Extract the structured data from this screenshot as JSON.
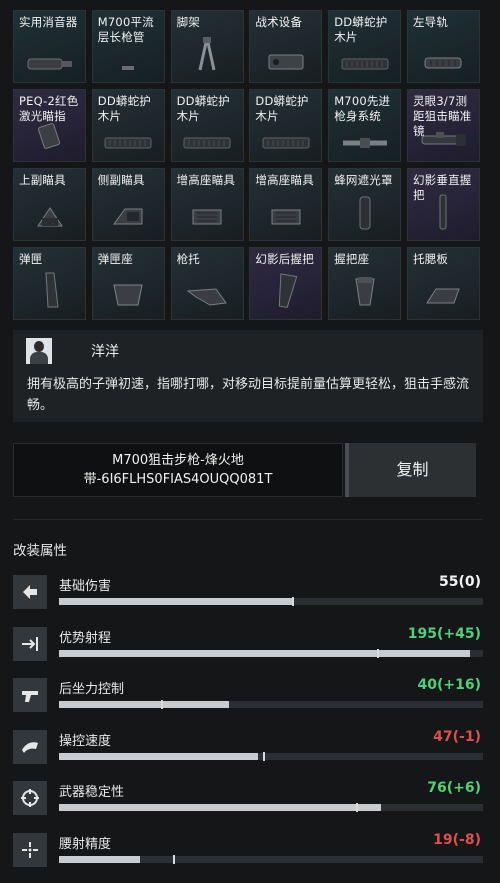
{
  "parts": [
    {
      "label": "实用消音器",
      "icon": "suppressor-icon",
      "bg": "teal"
    },
    {
      "label": "M700平流层长枪管",
      "icon": "barrel-icon",
      "bg": "teal"
    },
    {
      "label": "脚架",
      "icon": "bipod-icon",
      "bg": "dark"
    },
    {
      "label": "战术设备",
      "icon": "tactical-device-icon",
      "bg": "dark"
    },
    {
      "label": "DD蟒蛇护木片",
      "icon": "handguard-panel-icon",
      "bg": "teal"
    },
    {
      "label": "左导轨",
      "icon": "rail-icon",
      "bg": "teal"
    },
    {
      "label": "PEQ-2红色激光瞄指",
      "icon": "laser-icon",
      "bg": "purple"
    },
    {
      "label": "DD蟒蛇护木片",
      "icon": "handguard-panel-icon",
      "bg": "dark"
    },
    {
      "label": "DD蟒蛇护木片",
      "icon": "handguard-panel-icon",
      "bg": "dark"
    },
    {
      "label": "DD蟒蛇护木片",
      "icon": "handguard-panel-icon",
      "bg": "dark"
    },
    {
      "label": "M700先进枪身系统",
      "icon": "chassis-icon",
      "bg": "teal"
    },
    {
      "label": "灵眼3/7测距狙击瞄准镜",
      "icon": "scope-icon",
      "bg": "purple"
    },
    {
      "label": "上副瞄具",
      "icon": "sight-mount-icon",
      "bg": "dark"
    },
    {
      "label": "侧副瞄具",
      "icon": "side-sight-icon",
      "bg": "dark"
    },
    {
      "label": "增高座瞄具",
      "icon": "riser-mount-icon",
      "bg": "dark"
    },
    {
      "label": "增高座瞄具",
      "icon": "riser-mount-icon",
      "bg": "dark"
    },
    {
      "label": "蜂网遮光罩",
      "icon": "honeycomb-icon",
      "bg": "dark"
    },
    {
      "label": "幻影垂直握把",
      "icon": "vertical-grip-icon",
      "bg": "purple"
    },
    {
      "label": "弹匣",
      "icon": "magazine-icon",
      "bg": "dark"
    },
    {
      "label": "弹匣座",
      "icon": "magwell-icon",
      "bg": "dark"
    },
    {
      "label": "枪托",
      "icon": "stock-icon",
      "bg": "dark"
    },
    {
      "label": "幻影后握把",
      "icon": "pistol-grip-icon",
      "bg": "purple"
    },
    {
      "label": "握把座",
      "icon": "grip-mount-icon",
      "bg": "dark"
    },
    {
      "label": "托腮板",
      "icon": "cheek-rest-icon",
      "bg": "dark"
    }
  ],
  "description": {
    "author": "洋洋",
    "text": "拥有极高的子弹初速，指哪打哪，对移动目标提前量估算更轻松，狙击手感流畅。"
  },
  "code": {
    "line1": "M700狙击步枪-烽火地",
    "line2": "带-6I6FLHS0FIAS4OUQQ081T",
    "copy_label": "复制"
  },
  "attributes_title": "改装属性",
  "attributes": [
    {
      "name": "基础伤害",
      "value": "55(0)",
      "color": "#f2f2f2",
      "icon": "damage-icon",
      "fill": 0.55,
      "mark": 0.55
    },
    {
      "name": "优势射程",
      "value": "195(+45)",
      "color": "#4fd17a",
      "icon": "range-icon",
      "fill": 0.97,
      "mark": 0.75
    },
    {
      "name": "后坐力控制",
      "value": "40(+16)",
      "color": "#4fd17a",
      "icon": "recoil-icon",
      "fill": 0.4,
      "mark": 0.24
    },
    {
      "name": "操控速度",
      "value": "47(-1)",
      "color": "#e0504a",
      "icon": "handling-icon",
      "fill": 0.47,
      "mark": 0.48
    },
    {
      "name": "武器稳定性",
      "value": "76(+6)",
      "color": "#4fd17a",
      "icon": "stability-icon",
      "fill": 0.76,
      "mark": 0.7
    },
    {
      "name": "腰射精度",
      "value": "19(-8)",
      "color": "#e0504a",
      "icon": "hipfire-icon",
      "fill": 0.19,
      "mark": 0.27
    }
  ]
}
